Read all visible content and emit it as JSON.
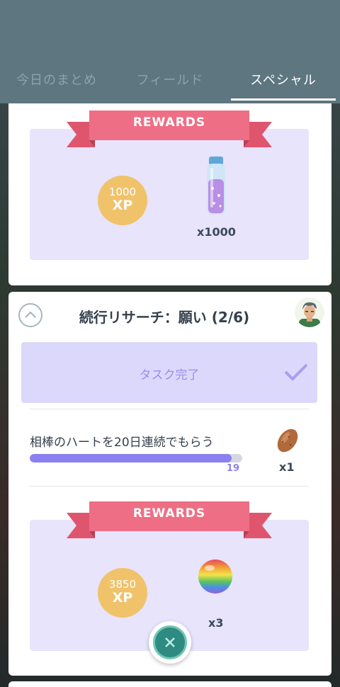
{
  "tabs": [
    {
      "label": "今日のまとめ",
      "active": false
    },
    {
      "label": "フィールド",
      "active": false
    },
    {
      "label": "スペシャル",
      "active": true
    }
  ],
  "rewards_top": {
    "banner": "REWARDS",
    "xp": {
      "amount": "1000",
      "label": "XP"
    },
    "item": {
      "icon": "stardust-bottle-icon",
      "quantity": "x1000"
    }
  },
  "research": {
    "title": "続行リサーチ：願い (2/6)",
    "task_complete_label": "タスク完了",
    "task": {
      "label": "相棒のハートを20日連続でもらう",
      "progress_count": "19",
      "progress_fraction": 0.95,
      "reward_quantity": "x1",
      "reward_icon": "nanab-berry-icon"
    },
    "rewards": {
      "banner": "REWARDS",
      "xp": {
        "amount": "3850",
        "label": "XP"
      },
      "item": {
        "icon": "rare-candy-icon",
        "quantity": "x3"
      }
    }
  },
  "colors": {
    "header": "#5d7680",
    "banner": "#ee6f85",
    "rewards_bg": "#e7e4fb",
    "xp_coin": "#f0c26a",
    "progress": "#8a80f0",
    "close_button": "#2f8a82"
  }
}
